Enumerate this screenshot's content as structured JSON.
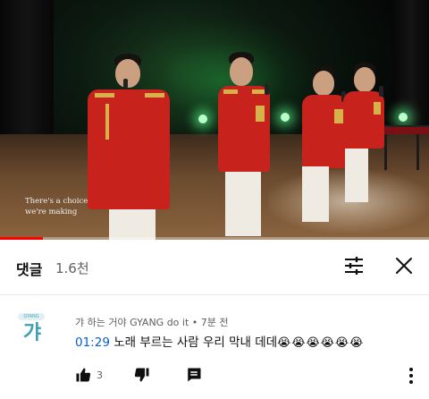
{
  "video": {
    "caption_line1": "There's a choice",
    "caption_line2": "we're making",
    "progress_fraction": 0.1,
    "accent_color": "#ff0000"
  },
  "comments": {
    "title": "댓글",
    "count": "1.6천",
    "sort_icon": "sort-filter-icon",
    "close_icon": "close-icon"
  },
  "comment": {
    "avatar_badge": "GYANG",
    "avatar_text": "갸",
    "meta": "갸 하는 거야 GYANG do it • 7분 전",
    "timestamp": "01:29",
    "body": " 노래 부르는 사람 우리 막내 데데",
    "emojis": "😭😭😭😭😭😭",
    "likes": "3",
    "like_icon": "thumbs-up-icon",
    "dislike_icon": "thumbs-down-icon",
    "reply_icon": "reply-icon",
    "more_icon": "more-vertical-icon"
  }
}
